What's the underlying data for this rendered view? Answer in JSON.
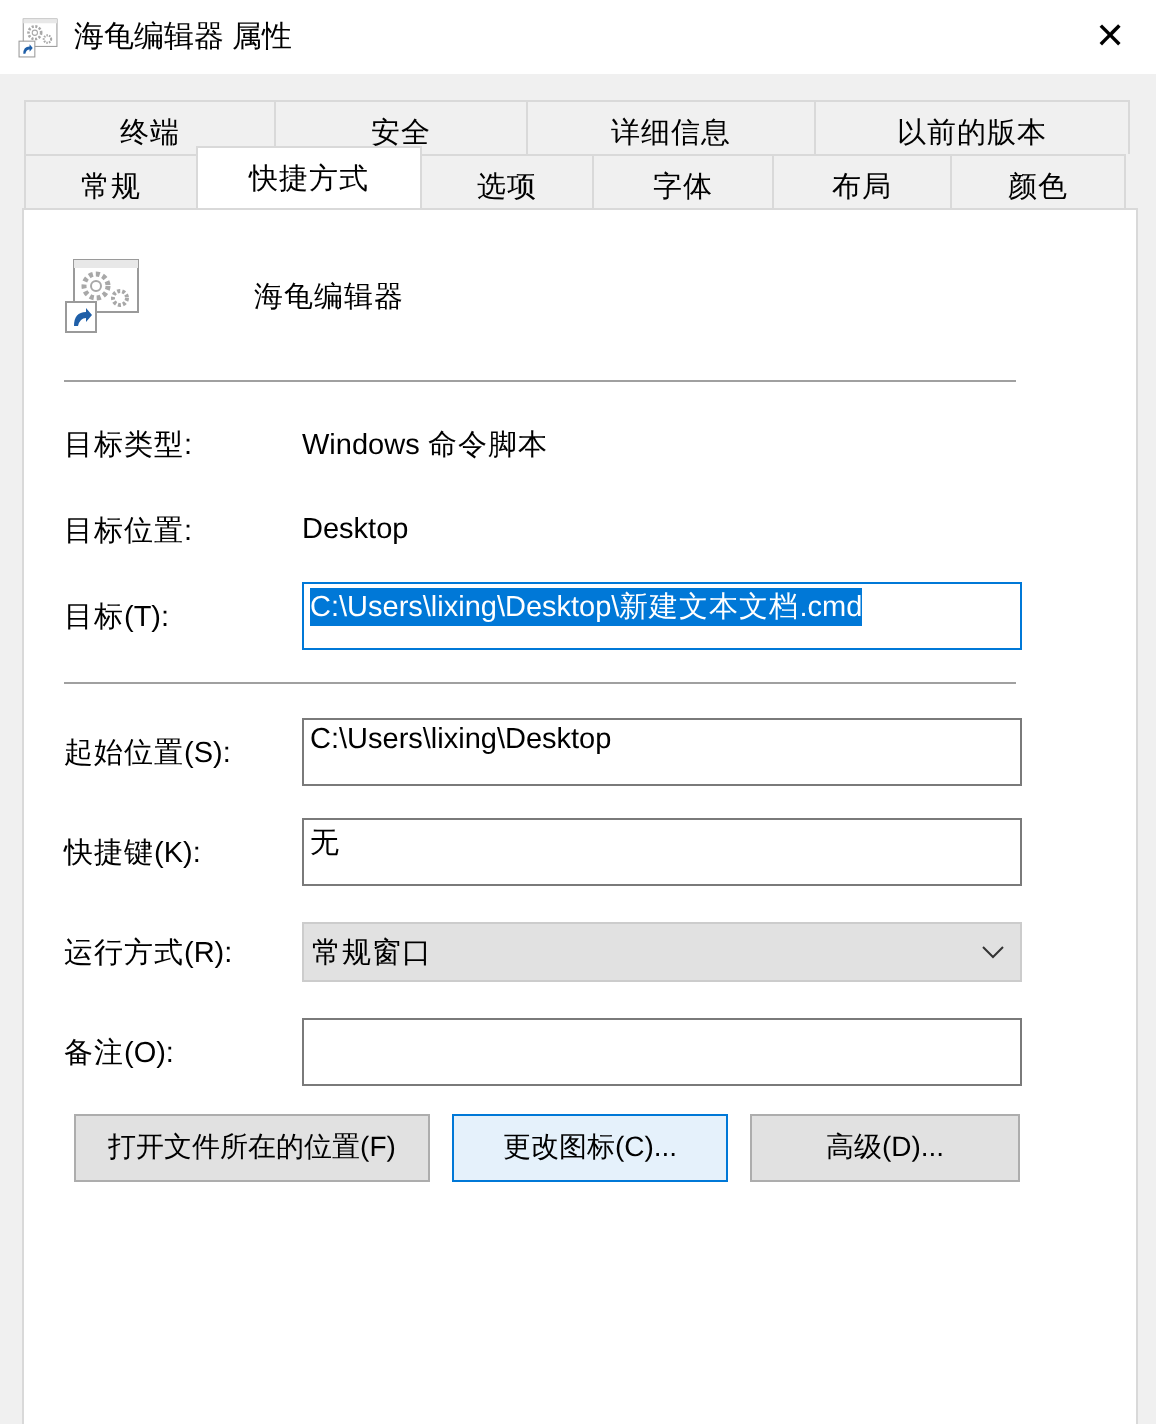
{
  "window": {
    "title": "海龟编辑器 属性",
    "close": "✕"
  },
  "tab_rows": [
    [
      {
        "label": "终端",
        "selected": false
      },
      {
        "label": "安全",
        "selected": false
      },
      {
        "label": "详细信息",
        "selected": false
      },
      {
        "label": "以前的版本",
        "selected": false
      }
    ],
    [
      {
        "label": "常规",
        "selected": false
      },
      {
        "label": "快捷方式",
        "selected": true
      },
      {
        "label": "选项",
        "selected": false
      },
      {
        "label": "字体",
        "selected": false
      },
      {
        "label": "布局",
        "selected": false
      },
      {
        "label": "颜色",
        "selected": false
      }
    ]
  ],
  "shortcut": {
    "name": "海龟编辑器"
  },
  "info_rows": [
    {
      "kind": "text",
      "label": "目标类型:",
      "value": "Windows 命令脚本"
    },
    {
      "kind": "text",
      "label": "目标位置:",
      "value": "Desktop"
    },
    {
      "kind": "field",
      "label": "目标(T):",
      "value": "C:\\Users\\lixing\\Desktop\\新建文本文档.cmd",
      "highlighted": true,
      "focused": true
    }
  ],
  "option_rows": [
    {
      "kind": "field",
      "label": "起始位置(S):",
      "value": "C:\\Users\\lixing\\Desktop",
      "focused": false
    },
    {
      "kind": "field",
      "label": "快捷键(K):",
      "value": "无",
      "focused": false
    },
    {
      "kind": "dropdown",
      "label": "运行方式(R):",
      "value": "常规窗口"
    },
    {
      "kind": "field",
      "label": "备注(O):",
      "focused": false
    }
  ],
  "buttons": [
    {
      "label": "打开文件所在的位置(F)",
      "focused": false
    },
    {
      "label": "更改图标(C)...",
      "focused": true
    },
    {
      "label": "高级(D)...",
      "focused": false
    }
  ]
}
